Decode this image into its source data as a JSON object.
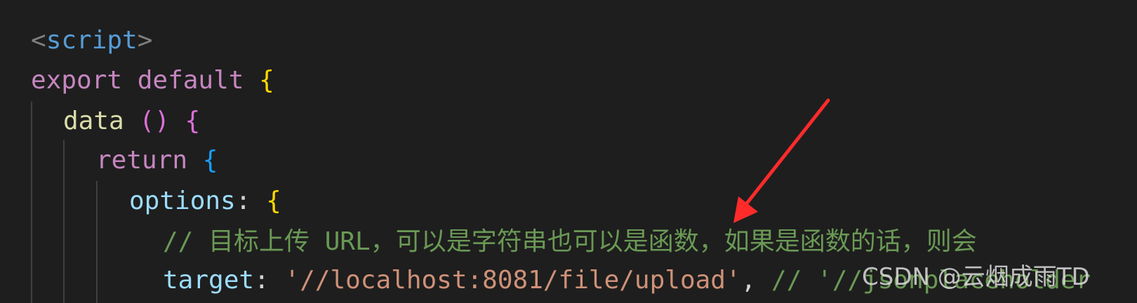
{
  "code": {
    "line1": {
      "open": "<",
      "tag": "script",
      "close": ">"
    },
    "line2": {
      "kw1": "export",
      "kw2": "default",
      "brace": "{"
    },
    "line3": {
      "fn": "data",
      "parens": "()",
      "brace": "{"
    },
    "line4": {
      "kw": "return",
      "brace": "{"
    },
    "line5": {
      "prop": "options",
      "colon": ":",
      "brace": "{"
    },
    "line6": {
      "comment": "// 目标上传 URL，可以是字符串也可以是函数，如果是函数的话，则会"
    },
    "line7": {
      "prop": "target",
      "colon": ":",
      "string": "'//localhost:8081/file/upload'",
      "comma": ",",
      "comment": "// '//jsonplaceholder"
    }
  },
  "watermark": "CSDN @云烟成雨TD",
  "annotation": {
    "arrow_color": "#ff2b2b"
  }
}
